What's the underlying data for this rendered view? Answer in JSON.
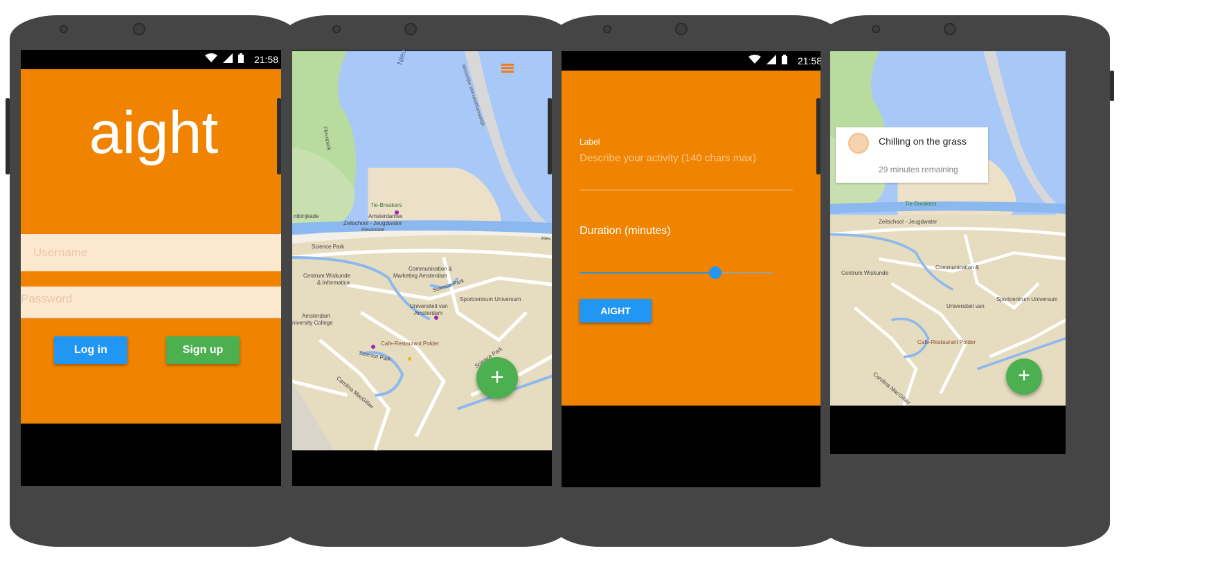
{
  "status": {
    "time": "21:58"
  },
  "login": {
    "app_name": "aight",
    "username_placeholder": "Username",
    "password_placeholder": "Password",
    "login_label": "Log in",
    "signup_label": "Sign up"
  },
  "map": {
    "labels": {
      "nieuwe": "Nieuwe D",
      "flevopark": "Flevopark",
      "tiebreakers": "Tie-Breakers",
      "amsterdamse": "Amsterdamse",
      "zeilschool": "Zeilschool - Jeugdwater",
      "flevoroute": "Flevoroute",
      "ntbinkade": "ntbinjkade",
      "sciencepark1": "Science Park",
      "communication": "Communication &",
      "marketing": "Marketing Amsterdam",
      "cwi1": "Centrum Wiskunde",
      "cwi2": "& Informatica",
      "sciencepark2": "Science Park",
      "sportcentrum": "Sportcentrum Universum",
      "uva1": "Universiteit van",
      "uva2": "Amsterdam",
      "auc1": "Amsterdam",
      "auc2": "niversity College",
      "cafe": "Cafe-Restaurant Polder",
      "sciencepark3": "Science Park",
      "sciencepark4": "Science Park",
      "carolina": "Carolina MacGillav",
      "westelijke": "Westelijke Merwedekanaaldijk",
      "flevo": "Flev"
    },
    "fab_symbol": "+"
  },
  "activity_form": {
    "label_title": "Label",
    "label_placeholder": "Describe your activity (140 chars max)",
    "duration_title": "Duration (minutes)",
    "slider_fraction": 0.7,
    "submit_label": "AIGHT"
  },
  "activity_card": {
    "title": "Chilling on the grass",
    "remaining": "29 minutes remaining"
  },
  "colors": {
    "orange": "#f08400",
    "blue": "#2196f3",
    "green": "#4caf50",
    "phone_body": "#454545",
    "water": "#a8c8f8",
    "park": "#b8dca0",
    "land": "#e8dcc0"
  }
}
